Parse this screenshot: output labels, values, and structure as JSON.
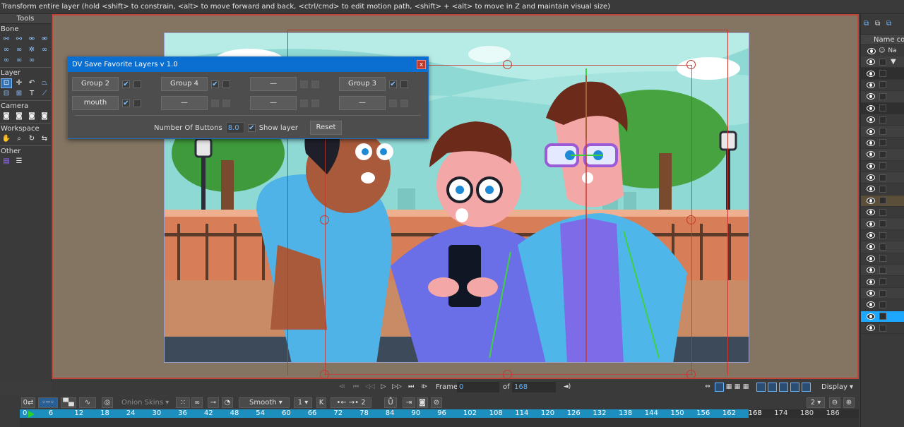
{
  "status_text": "Transform entire layer (hold <shift> to constrain, <alt> to move forward and back, <ctrl/cmd> to edit motion path, <shift> + <alt> to move in Z and maintain visual size)",
  "tools": {
    "title": "Tools",
    "sections": {
      "bone": "Bone",
      "layer": "Layer",
      "camera": "Camera",
      "workspace": "Workspace",
      "other": "Other"
    }
  },
  "dialog": {
    "title": "DV Save Favorite Layers v 1.0",
    "close": "x",
    "buttons": [
      {
        "label": "Group 2",
        "checked": true
      },
      {
        "label": "Group 4",
        "checked": true
      },
      {
        "label": "—",
        "checked": false
      },
      {
        "label": "Group 3",
        "checked": true
      },
      {
        "label": "mouth",
        "checked": true
      },
      {
        "label": "—",
        "checked": false
      },
      {
        "label": "—",
        "checked": false
      },
      {
        "label": "—",
        "checked": false
      }
    ],
    "number_label": "Number Of Buttons",
    "number_value": "8.0",
    "show_layer_label": "Show layer",
    "reset_label": "Reset"
  },
  "layers_panel": {
    "name_header": "Name con",
    "col_header": "Na"
  },
  "playback": {
    "frame_label": "Frame",
    "frame_value": "0",
    "of_label": "of",
    "total_frames": "168",
    "display_label": "Display"
  },
  "timeline": {
    "onion_label": "Onion Skins",
    "interp_label": "Smooth",
    "interp_value": "1",
    "key_count": "2",
    "zoom_value": "2",
    "ruler": [
      "0",
      "6",
      "12",
      "18",
      "24",
      "30",
      "36",
      "42",
      "48",
      "54",
      "60",
      "66",
      "72",
      "78",
      "84",
      "90",
      "96",
      "102",
      "108",
      "114",
      "120",
      "126",
      "132",
      "138",
      "144",
      "150",
      "156",
      "162",
      "168",
      "174",
      "180",
      "186"
    ]
  },
  "colors": {
    "accent": "#0a6fd1",
    "selection": "#1ea7ff",
    "canvas_bg": "#847562",
    "frame_border": "#c0443a",
    "timeline_fill": "#1d8fbf"
  }
}
